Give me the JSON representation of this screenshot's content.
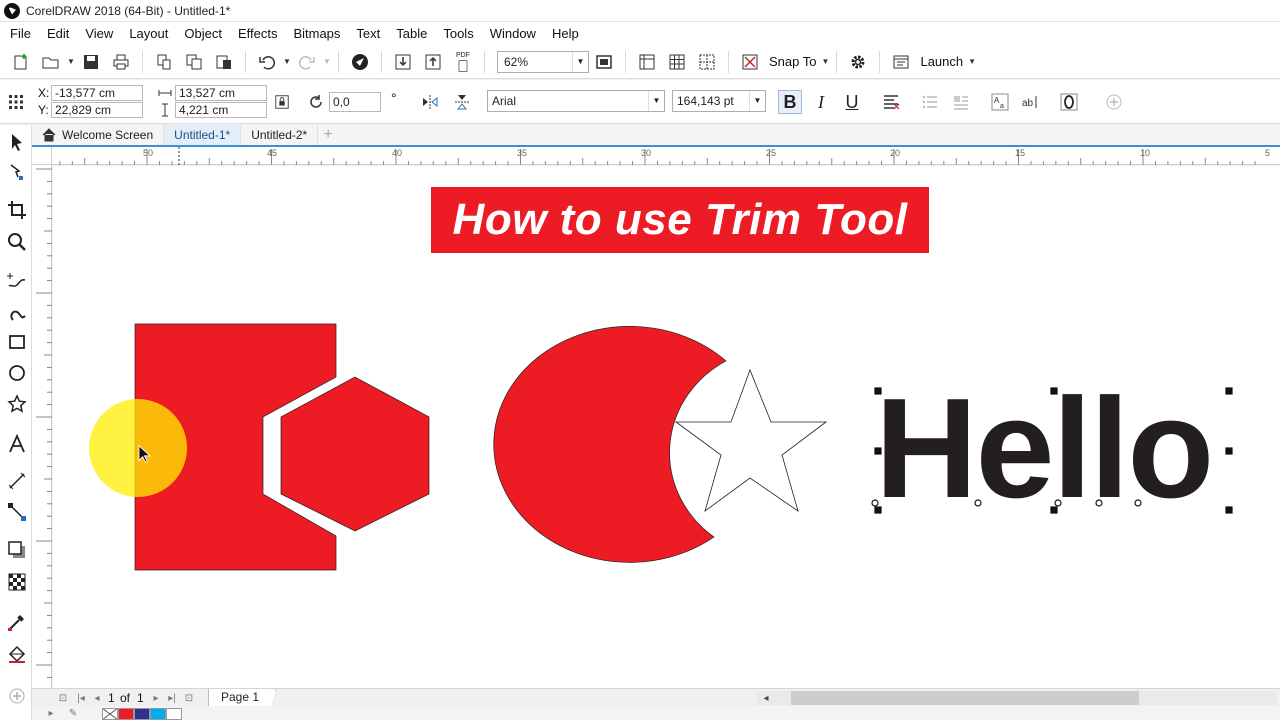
{
  "window": {
    "title": "CorelDRAW 2018 (64-Bit) - Untitled-1*"
  },
  "menu": [
    {
      "label": "File"
    },
    {
      "label": "Edit"
    },
    {
      "label": "View"
    },
    {
      "label": "Layout"
    },
    {
      "label": "Object"
    },
    {
      "label": "Effects"
    },
    {
      "label": "Bitmaps"
    },
    {
      "label": "Text"
    },
    {
      "label": "Table"
    },
    {
      "label": "Tools"
    },
    {
      "label": "Window"
    },
    {
      "label": "Help"
    }
  ],
  "toolbar": {
    "zoom_value": "62%",
    "snap_label": "Snap To",
    "launch_label": "Launch",
    "pdf_label": "PDF"
  },
  "propbar": {
    "x_label": "X:",
    "x_value": "-13,577 cm",
    "y_label": "Y:",
    "y_value": "22,829 cm",
    "width_value": "13,527 cm",
    "height_value": "4,221 cm",
    "rotation_value": "0,0",
    "degree_symbol": "°",
    "font_name": "Arial",
    "font_size": "164,143 pt",
    "bold_label": "B",
    "italic_label": "I",
    "underline_label": "U"
  },
  "tabs": [
    {
      "label": "Welcome Screen",
      "active": false
    },
    {
      "label": "Untitled-1*",
      "active": true
    },
    {
      "label": "Untitled-2*",
      "active": false
    }
  ],
  "ruler": {
    "h_labels": [
      "50",
      "45",
      "40",
      "35",
      "30",
      "25",
      "20",
      "15",
      "10",
      "5"
    ]
  },
  "canvas": {
    "banner_text": "How to use Trim Tool",
    "hello_text": "Hello"
  },
  "pagenav": {
    "page_current": "1",
    "of_label": "of",
    "page_total": "1",
    "page_tab_label": "Page 1"
  },
  "colors": {
    "red": "#ed1c24",
    "banner": "#ed1c24",
    "text_dark": "#231f20",
    "accent": "#3d8fd6",
    "highlight": "#fff23a"
  }
}
